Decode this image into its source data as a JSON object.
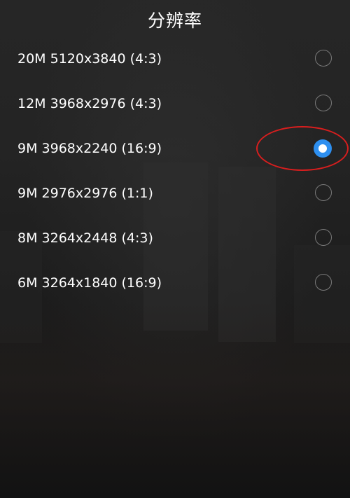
{
  "dialog": {
    "title": "分辨率"
  },
  "options": [
    {
      "label": "20M 5120x3840 (4:3)",
      "selected": false
    },
    {
      "label": "12M 3968x2976 (4:3)",
      "selected": false
    },
    {
      "label": "9M 3968x2240 (16:9)",
      "selected": true
    },
    {
      "label": "9M 2976x2976 (1:1)",
      "selected": false
    },
    {
      "label": "8M 3264x2448 (4:3)",
      "selected": false
    },
    {
      "label": "6M 3264x1840 (16:9)",
      "selected": false
    }
  ],
  "colors": {
    "accent": "#2d8ff0",
    "annotation": "#d81e1e",
    "text": "#ffffff"
  }
}
